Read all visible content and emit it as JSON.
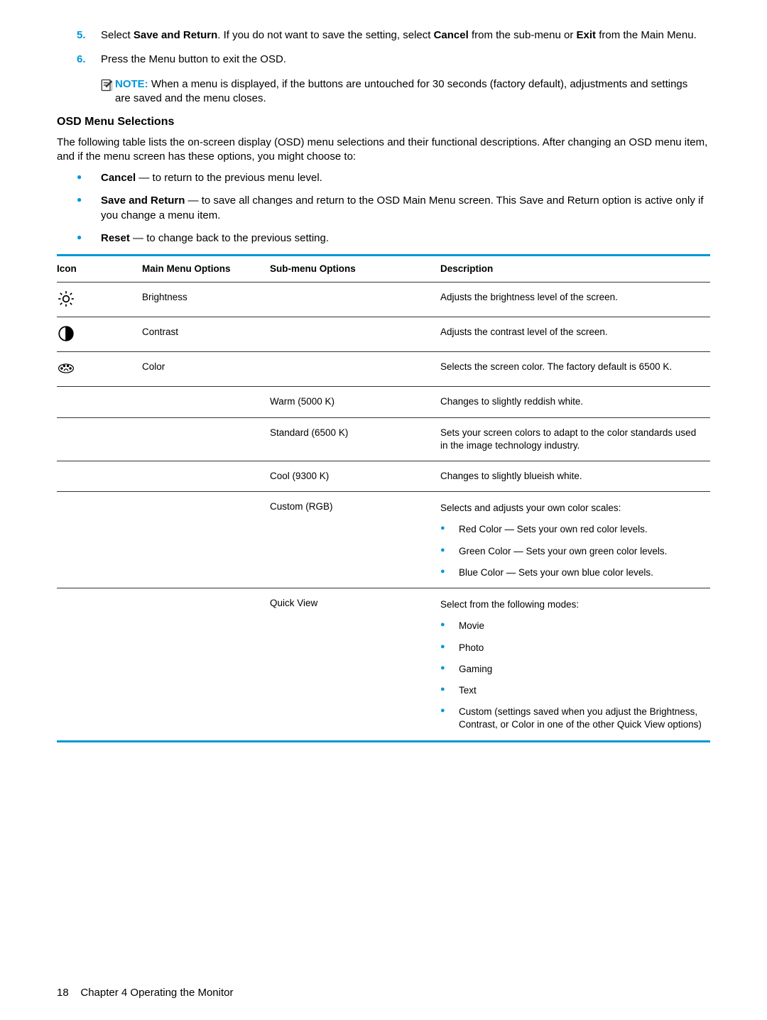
{
  "steps": [
    {
      "num": "5.",
      "prefix": "Select ",
      "b1": "Save and Return",
      "mid1": ". If you do not want to save the setting, select ",
      "b2": "Cancel",
      "mid2": " from the sub-menu or ",
      "b3": "Exit",
      "suffix": " from the Main Menu."
    },
    {
      "num": "6.",
      "text": "Press the Menu button to exit the OSD."
    }
  ],
  "note": {
    "label": "NOTE:",
    "text": "   When a menu is displayed, if the buttons are untouched for 30 seconds (factory default), adjustments and settings are saved and the menu closes."
  },
  "sectionHead": "OSD Menu Selections",
  "introPara": "The following table lists the on-screen display (OSD) menu selections and their functional descriptions. After changing an OSD menu item, and if the menu screen has these options, you might choose to:",
  "mainBullets": [
    {
      "bold": "Cancel",
      "rest": " — to return to the previous menu level."
    },
    {
      "bold": "Save and Return",
      "rest": " — to save all changes and return to the OSD Main Menu screen. This Save and Return option is active only if you change a menu item."
    },
    {
      "bold": "Reset",
      "rest": " — to change back to the previous setting."
    }
  ],
  "table": {
    "headers": {
      "icon": "Icon",
      "main": "Main Menu Options",
      "sub": "Sub-menu Options",
      "desc": "Description"
    },
    "rows": [
      {
        "icon": "brightness",
        "main": "Brightness",
        "sub": "",
        "desc": "Adjusts the brightness level of the screen."
      },
      {
        "icon": "contrast",
        "main": "Contrast",
        "sub": "",
        "desc": "Adjusts the contrast level of the screen."
      },
      {
        "icon": "color",
        "main": "Color",
        "sub": "",
        "desc": "Selects the screen color. The factory default is 6500 K."
      },
      {
        "icon": "",
        "main": "",
        "sub": "Warm (5000 K)",
        "desc": "Changes to slightly reddish white."
      },
      {
        "icon": "",
        "main": "",
        "sub": "Standard (6500 K)",
        "desc": "Sets your screen colors to adapt to the color standards used in the image technology industry."
      },
      {
        "icon": "",
        "main": "",
        "sub": "Cool (9300 K)",
        "desc": "Changes to slightly blueish white."
      },
      {
        "icon": "",
        "main": "",
        "sub": "Custom (RGB)",
        "descLead": "Selects and adjusts your own color scales:",
        "items": [
          "Red Color — Sets your own red color levels.",
          "Green Color — Sets your own green color levels.",
          "Blue Color — Sets your own blue color levels."
        ]
      },
      {
        "icon": "",
        "main": "",
        "sub": "Quick View",
        "descLead": "Select from the following modes:",
        "items": [
          "Movie",
          "Photo",
          "Gaming",
          "Text",
          "Custom (settings saved when you adjust the Brightness, Contrast, or Color in one of the other Quick View options)"
        ],
        "last": true
      }
    ]
  },
  "footer": {
    "page": "18",
    "chapter": "Chapter 4   Operating the Monitor"
  }
}
